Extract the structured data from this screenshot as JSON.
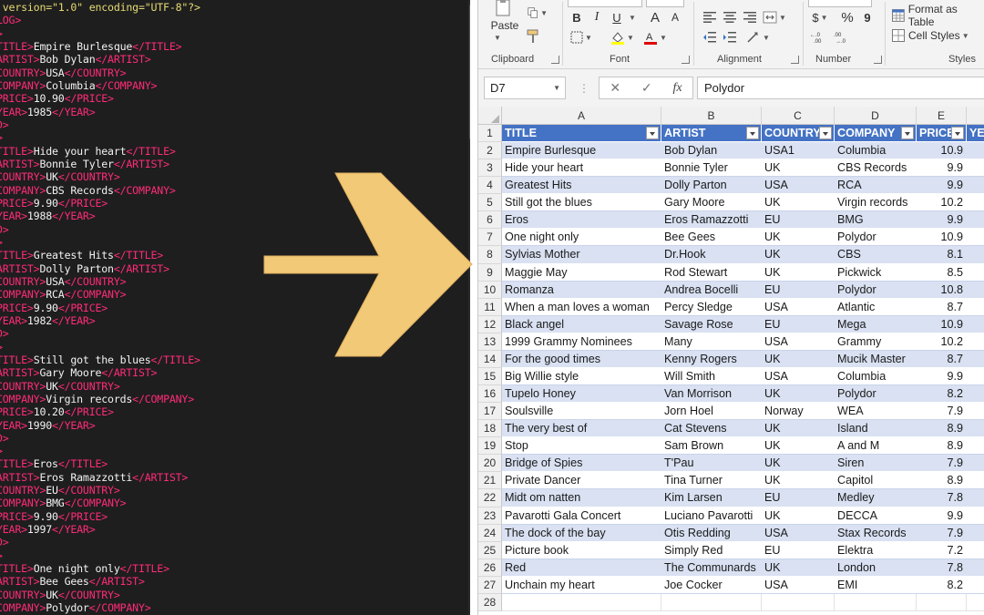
{
  "editor": {
    "lines": [
      [
        [
          "attr",
          " version=\"1.0\" encoding=\"UTF-8\"?>"
        ]
      ],
      [
        [
          "tag",
          "LOG>"
        ]
      ],
      [
        [
          "tag",
          ">"
        ]
      ],
      [
        [
          "tag",
          "TITLE>"
        ],
        [
          "txt",
          "Empire Burlesque"
        ],
        [
          "tag",
          "</TITLE>"
        ]
      ],
      [
        [
          "tag",
          "ARTIST>"
        ],
        [
          "txt",
          "Bob Dylan"
        ],
        [
          "tag",
          "</ARTIST>"
        ]
      ],
      [
        [
          "tag",
          "COUNTRY>"
        ],
        [
          "txt",
          "USA"
        ],
        [
          "tag",
          "</COUNTRY>"
        ]
      ],
      [
        [
          "tag",
          "COMPANY>"
        ],
        [
          "txt",
          "Columbia"
        ],
        [
          "tag",
          "</COMPANY>"
        ]
      ],
      [
        [
          "tag",
          "PRICE>"
        ],
        [
          "txt",
          "10.90"
        ],
        [
          "tag",
          "</PRICE>"
        ]
      ],
      [
        [
          "tag",
          "YEAR>"
        ],
        [
          "txt",
          "1985"
        ],
        [
          "tag",
          "</YEAR>"
        ]
      ],
      [
        [
          "tag",
          "D>"
        ]
      ],
      [
        [
          "tag",
          ">"
        ]
      ],
      [
        [
          "tag",
          "TITLE>"
        ],
        [
          "txt",
          "Hide your heart"
        ],
        [
          "tag",
          "</TITLE>"
        ]
      ],
      [
        [
          "tag",
          "ARTIST>"
        ],
        [
          "txt",
          "Bonnie Tyler"
        ],
        [
          "tag",
          "</ARTIST>"
        ]
      ],
      [
        [
          "tag",
          "COUNTRY>"
        ],
        [
          "txt",
          "UK"
        ],
        [
          "tag",
          "</COUNTRY>"
        ]
      ],
      [
        [
          "tag",
          "COMPANY>"
        ],
        [
          "txt",
          "CBS Records"
        ],
        [
          "tag",
          "</COMPANY>"
        ]
      ],
      [
        [
          "tag",
          "PRICE>"
        ],
        [
          "txt",
          "9.90"
        ],
        [
          "tag",
          "</PRICE>"
        ]
      ],
      [
        [
          "tag",
          "YEAR>"
        ],
        [
          "txt",
          "1988"
        ],
        [
          "tag",
          "</YEAR>"
        ]
      ],
      [
        [
          "tag",
          "D>"
        ]
      ],
      [
        [
          "tag",
          ">"
        ]
      ],
      [
        [
          "tag",
          "TITLE>"
        ],
        [
          "txt",
          "Greatest Hits"
        ],
        [
          "tag",
          "</TITLE>"
        ]
      ],
      [
        [
          "tag",
          "ARTIST>"
        ],
        [
          "txt",
          "Dolly Parton"
        ],
        [
          "tag",
          "</ARTIST>"
        ]
      ],
      [
        [
          "tag",
          "COUNTRY>"
        ],
        [
          "txt",
          "USA"
        ],
        [
          "tag",
          "</COUNTRY>"
        ]
      ],
      [
        [
          "tag",
          "COMPANY>"
        ],
        [
          "txt",
          "RCA"
        ],
        [
          "tag",
          "</COMPANY>"
        ]
      ],
      [
        [
          "tag",
          "PRICE>"
        ],
        [
          "txt",
          "9.90"
        ],
        [
          "tag",
          "</PRICE>"
        ]
      ],
      [
        [
          "tag",
          "YEAR>"
        ],
        [
          "txt",
          "1982"
        ],
        [
          "tag",
          "</YEAR>"
        ]
      ],
      [
        [
          "tag",
          "D>"
        ]
      ],
      [
        [
          "tag",
          ">"
        ]
      ],
      [
        [
          "tag",
          "TITLE>"
        ],
        [
          "txt",
          "Still got the blues"
        ],
        [
          "tag",
          "</TITLE>"
        ]
      ],
      [
        [
          "tag",
          "ARTIST>"
        ],
        [
          "txt",
          "Gary Moore"
        ],
        [
          "tag",
          "</ARTIST>"
        ]
      ],
      [
        [
          "tag",
          "COUNTRY>"
        ],
        [
          "txt",
          "UK"
        ],
        [
          "tag",
          "</COUNTRY>"
        ]
      ],
      [
        [
          "tag",
          "COMPANY>"
        ],
        [
          "txt",
          "Virgin records"
        ],
        [
          "tag",
          "</COMPANY>"
        ]
      ],
      [
        [
          "tag",
          "PRICE>"
        ],
        [
          "txt",
          "10.20"
        ],
        [
          "tag",
          "</PRICE>"
        ]
      ],
      [
        [
          "tag",
          "YEAR>"
        ],
        [
          "txt",
          "1990"
        ],
        [
          "tag",
          "</YEAR>"
        ]
      ],
      [
        [
          "tag",
          "D>"
        ]
      ],
      [
        [
          "tag",
          ">"
        ]
      ],
      [
        [
          "tag",
          "TITLE>"
        ],
        [
          "txt",
          "Eros"
        ],
        [
          "tag",
          "</TITLE>"
        ]
      ],
      [
        [
          "tag",
          "ARTIST>"
        ],
        [
          "txt",
          "Eros Ramazzotti"
        ],
        [
          "tag",
          "</ARTIST>"
        ]
      ],
      [
        [
          "tag",
          "COUNTRY>"
        ],
        [
          "txt",
          "EU"
        ],
        [
          "tag",
          "</COUNTRY>"
        ]
      ],
      [
        [
          "tag",
          "COMPANY>"
        ],
        [
          "txt",
          "BMG"
        ],
        [
          "tag",
          "</COMPANY>"
        ]
      ],
      [
        [
          "tag",
          "PRICE>"
        ],
        [
          "txt",
          "9.90"
        ],
        [
          "tag",
          "</PRICE>"
        ]
      ],
      [
        [
          "tag",
          "YEAR>"
        ],
        [
          "txt",
          "1997"
        ],
        [
          "tag",
          "</YEAR>"
        ]
      ],
      [
        [
          "tag",
          "D>"
        ]
      ],
      [
        [
          "tag",
          ">"
        ]
      ],
      [
        [
          "tag",
          "TITLE>"
        ],
        [
          "txt",
          "One night only"
        ],
        [
          "tag",
          "</TITLE>"
        ]
      ],
      [
        [
          "tag",
          "ARTIST>"
        ],
        [
          "txt",
          "Bee Gees"
        ],
        [
          "tag",
          "</ARTIST>"
        ]
      ],
      [
        [
          "tag",
          "COUNTRY>"
        ],
        [
          "txt",
          "UK"
        ],
        [
          "tag",
          "</COUNTRY>"
        ]
      ],
      [
        [
          "tag",
          "COMPANY>"
        ],
        [
          "txt",
          "Polydor"
        ],
        [
          "tag",
          "</COMPANY>"
        ]
      ]
    ]
  },
  "ribbon": {
    "paste_label": "Paste",
    "groups": {
      "clipboard": "Clipboard",
      "font": "Font",
      "alignment": "Alignment",
      "number": "Number",
      "styles": "Styles"
    },
    "font_buttons": {
      "bold": "B",
      "italic": "I",
      "underline": "U",
      "grow": "A",
      "shrink": "A"
    },
    "number_buttons": {
      "currency": "$",
      "percent": "%",
      "comma": "9"
    },
    "format_as_table": "Format as Table",
    "cell_styles": "Cell Styles"
  },
  "formula_bar": {
    "name_box": "D7",
    "fx": "fx",
    "value": "Polydor"
  },
  "sheet": {
    "columns": [
      "A",
      "B",
      "C",
      "D",
      "E"
    ],
    "headers": [
      "TITLE",
      "ARTIST",
      "COUNTRY",
      "COMPANY",
      "PRICE",
      "YEA"
    ],
    "rows": [
      [
        "Empire Burlesque",
        "Bob Dylan",
        "USA1",
        "Columbia",
        "10.9"
      ],
      [
        "Hide your heart",
        "Bonnie Tyler",
        "UK",
        "CBS Records",
        "9.9"
      ],
      [
        "Greatest Hits",
        "Dolly Parton",
        "USA",
        "RCA",
        "9.9"
      ],
      [
        "Still got the blues",
        "Gary Moore",
        "UK",
        "Virgin records",
        "10.2"
      ],
      [
        "Eros",
        "Eros Ramazzotti",
        "EU",
        "BMG",
        "9.9"
      ],
      [
        "One night only",
        "Bee Gees",
        "UK",
        "Polydor",
        "10.9"
      ],
      [
        "Sylvias Mother",
        "Dr.Hook",
        "UK",
        "CBS",
        "8.1"
      ],
      [
        "Maggie May",
        "Rod Stewart",
        "UK",
        "Pickwick",
        "8.5"
      ],
      [
        "Romanza",
        "Andrea Bocelli",
        "EU",
        "Polydor",
        "10.8"
      ],
      [
        "When a man loves a woman",
        "Percy Sledge",
        "USA",
        "Atlantic",
        "8.7"
      ],
      [
        "Black angel",
        "Savage Rose",
        "EU",
        "Mega",
        "10.9"
      ],
      [
        "1999 Grammy Nominees",
        "Many",
        "USA",
        "Grammy",
        "10.2"
      ],
      [
        "For the good times",
        "Kenny Rogers",
        "UK",
        "Mucik Master",
        "8.7"
      ],
      [
        "Big Willie style",
        "Will Smith",
        "USA",
        "Columbia",
        "9.9"
      ],
      [
        "Tupelo Honey",
        "Van Morrison",
        "UK",
        "Polydor",
        "8.2"
      ],
      [
        "Soulsville",
        "Jorn Hoel",
        "Norway",
        "WEA",
        "7.9"
      ],
      [
        "The very best of",
        "Cat Stevens",
        "UK",
        "Island",
        "8.9"
      ],
      [
        "Stop",
        "Sam Brown",
        "UK",
        "A and M",
        "8.9"
      ],
      [
        "Bridge of Spies",
        "T'Pau",
        "UK",
        "Siren",
        "7.9"
      ],
      [
        "Private Dancer",
        "Tina Turner",
        "UK",
        "Capitol",
        "8.9"
      ],
      [
        "Midt om natten",
        "Kim Larsen",
        "EU",
        "Medley",
        "7.8"
      ],
      [
        "Pavarotti Gala Concert",
        "Luciano Pavarotti",
        "UK",
        "DECCA",
        "9.9"
      ],
      [
        "The dock of the bay",
        "Otis Redding",
        "USA",
        "Stax Records",
        "7.9"
      ],
      [
        "Picture book",
        "Simply Red",
        "EU",
        "Elektra",
        "7.2"
      ],
      [
        "Red",
        "The Communards",
        "UK",
        "London",
        "7.8"
      ],
      [
        "Unchain my heart",
        "Joe Cocker",
        "USA",
        "EMI",
        "8.2"
      ]
    ],
    "row_numbers": [
      "1",
      "2",
      "3",
      "4",
      "5",
      "6",
      "7",
      "8",
      "9",
      "10",
      "11",
      "12",
      "13",
      "14",
      "15",
      "16",
      "17",
      "18",
      "19",
      "20",
      "21",
      "22",
      "23",
      "24",
      "25",
      "26",
      "27",
      "28"
    ]
  },
  "colors": {
    "editor_bg": "#1e1e1e",
    "xml_tag": "#ff2b77",
    "table_header": "#4472c4",
    "table_band": "#d9e1f2",
    "arrow_fill": "#f2c977"
  }
}
